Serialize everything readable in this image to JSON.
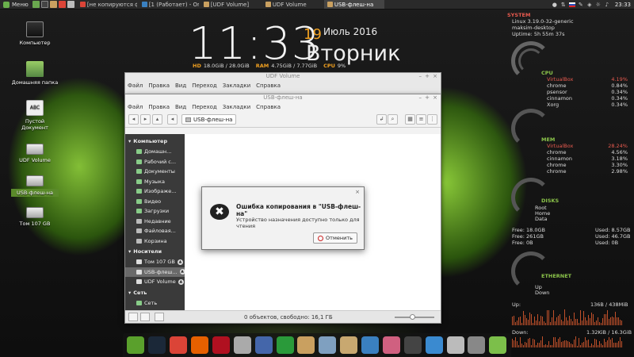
{
  "top_panel": {
    "menu_label": "Меню",
    "tasks": [
      {
        "label": "[не копируются ф",
        "active": false
      },
      {
        "label": "[1 (Работает) - Ora",
        "active": false
      },
      {
        "label": "[UDF Volume]",
        "active": false
      },
      {
        "label": "UDF Volume",
        "active": false
      },
      {
        "label": "USB-флеш-на",
        "active": true
      }
    ],
    "tray_icons": [
      "user-icon",
      "network-icon",
      "flag-ru-icon",
      "pencil-icon",
      "shield-icon",
      "brightness-icon",
      "volume-icon"
    ],
    "clock": "23:33"
  },
  "desktop_icons": [
    {
      "label": "Компьютер",
      "icon": "computer-icon"
    },
    {
      "label": "Домашняя папка",
      "icon": "home-folder-icon"
    },
    {
      "label": "Пустой Документ",
      "icon": "document-icon",
      "badge": "ABC"
    },
    {
      "label": "UDF Volume",
      "icon": "drive-icon"
    },
    {
      "label": "USB-флеш-на",
      "icon": "usb-drive-icon",
      "selected": true
    },
    {
      "label": "Том 107 GB",
      "icon": "drive-icon"
    }
  ],
  "clock_widget": {
    "time": "11:33",
    "day": "19",
    "month_year": "Июль 2016",
    "weekday": "Вторник",
    "hd_label": "HD",
    "hd_value": "18.0GiB / 28.0GiB",
    "ram_label": "RAM",
    "ram_value": "4.75GiB / 7.77GiB",
    "cpu_label": "CPU",
    "cpu_value": "9%"
  },
  "conky": {
    "system_header": "SYSTEM",
    "kernel": "Linux 3.19.0-32-generic",
    "host": "maksim-desktop",
    "uptime": "Uptime: 5h 55m 37s",
    "cpu_header": "CPU",
    "cpu_procs": [
      {
        "name": "VirtualBox",
        "value": "4.19%"
      },
      {
        "name": "chrome",
        "value": "0.84%"
      },
      {
        "name": "psensor",
        "value": "0.34%"
      },
      {
        "name": "cinnamon",
        "value": "0.34%"
      },
      {
        "name": "Xorg",
        "value": "0.34%"
      }
    ],
    "mem_header": "MEM",
    "mem_procs": [
      {
        "name": "VirtualBox",
        "value": "28.24%"
      },
      {
        "name": "chrome",
        "value": "4.56%"
      },
      {
        "name": "cinnamon",
        "value": "3.18%"
      },
      {
        "name": "chrome",
        "value": "3.30%"
      },
      {
        "name": "chrome",
        "value": "2.98%"
      }
    ],
    "disks_header": "DISKS",
    "disk_names": [
      "Root",
      "Home",
      "Data"
    ],
    "disk_stats": [
      {
        "free": "Free: 18.0GB",
        "used": "Used: 8.57GB"
      },
      {
        "free": "Free: 261GB",
        "used": "Used: 46.7GB"
      },
      {
        "free": "Free: 0B",
        "used": "Used: 0B"
      }
    ],
    "ethernet_header": "ETHERNET",
    "eth_labels": [
      "Up",
      "Down"
    ],
    "up_label": "Up:",
    "up_value": "136B / 438MiB",
    "down_label": "Down:",
    "down_value": "1.32KiB / 16.3GiB"
  },
  "back_window": {
    "title": "UDF Volume",
    "menu": [
      "Файл",
      "Правка",
      "Вид",
      "Переход",
      "Закладки",
      "Справка"
    ]
  },
  "window": {
    "title": "USB-флеш-на",
    "menu": [
      "Файл",
      "Правка",
      "Вид",
      "Переход",
      "Закладки",
      "Справка"
    ],
    "location": "USB-флеш-на",
    "sidebar": {
      "sections": [
        {
          "header": "Компьютер",
          "items": [
            {
              "label": "Домашн...",
              "selected": false,
              "eject": false
            },
            {
              "label": "Рабочий с...",
              "selected": false,
              "eject": false
            },
            {
              "label": "Документы",
              "selected": false,
              "eject": false
            },
            {
              "label": "Музыка",
              "selected": false,
              "eject": false
            },
            {
              "label": "Изображе...",
              "selected": false,
              "eject": false
            },
            {
              "label": "Видео",
              "selected": false,
              "eject": false
            },
            {
              "label": "Загрузки",
              "selected": false,
              "eject": false
            },
            {
              "label": "Недавние",
              "selected": false,
              "eject": false
            },
            {
              "label": "Файловая...",
              "selected": false,
              "eject": false
            },
            {
              "label": "Корзина",
              "selected": false,
              "eject": false
            }
          ]
        },
        {
          "header": "Носители",
          "items": [
            {
              "label": "Том 107 GB",
              "selected": false,
              "eject": true
            },
            {
              "label": "USB-флеш...",
              "selected": true,
              "eject": true
            },
            {
              "label": "UDF Volume",
              "selected": false,
              "eject": true
            }
          ]
        },
        {
          "header": "Сеть",
          "items": [
            {
              "label": "Сеть",
              "selected": false,
              "eject": false
            }
          ]
        }
      ]
    },
    "status_text": "0 объектов, свободно: 16,1 ГБ",
    "zoom_level": 0.45
  },
  "dialog": {
    "title": "Ошибка копирования в \"USB-флеш-на\"",
    "message": "Устройство назначения доступно только для чтения",
    "cancel_label": "Отменить",
    "close_glyph": "×"
  },
  "dock": {
    "apps": [
      {
        "icon": "anchor-icon",
        "color": "#5aa02c"
      },
      {
        "icon": "steam-icon",
        "color": "#1b2838"
      },
      {
        "icon": "chrome-icon",
        "color": "#db4437"
      },
      {
        "icon": "firefox-icon",
        "color": "#e66000"
      },
      {
        "icon": "cherry-icon",
        "color": "#b01020"
      },
      {
        "icon": "calculator-icon",
        "color": "#aaaaaa"
      },
      {
        "icon": "cursor-icon",
        "color": "#4466aa"
      },
      {
        "icon": "sync-icon",
        "color": "#2a9a3a"
      },
      {
        "icon": "archive-icon",
        "color": "#c9a060"
      },
      {
        "icon": "scanner-icon",
        "color": "#7fa0c0"
      },
      {
        "icon": "package-icon",
        "color": "#c8a870"
      },
      {
        "icon": "network-icon",
        "color": "#3a80c0"
      },
      {
        "icon": "color-picker-icon",
        "color": "#d06080"
      },
      {
        "icon": "monitor-icon",
        "color": "#444444"
      },
      {
        "icon": "system-monitor-icon",
        "color": "#3a8ad0"
      },
      {
        "icon": "disks-icon",
        "color": "#bbbbbb"
      },
      {
        "icon": "search-icon",
        "color": "#888888"
      },
      {
        "icon": "folder-icon",
        "color": "#7cbf4a"
      }
    ]
  }
}
